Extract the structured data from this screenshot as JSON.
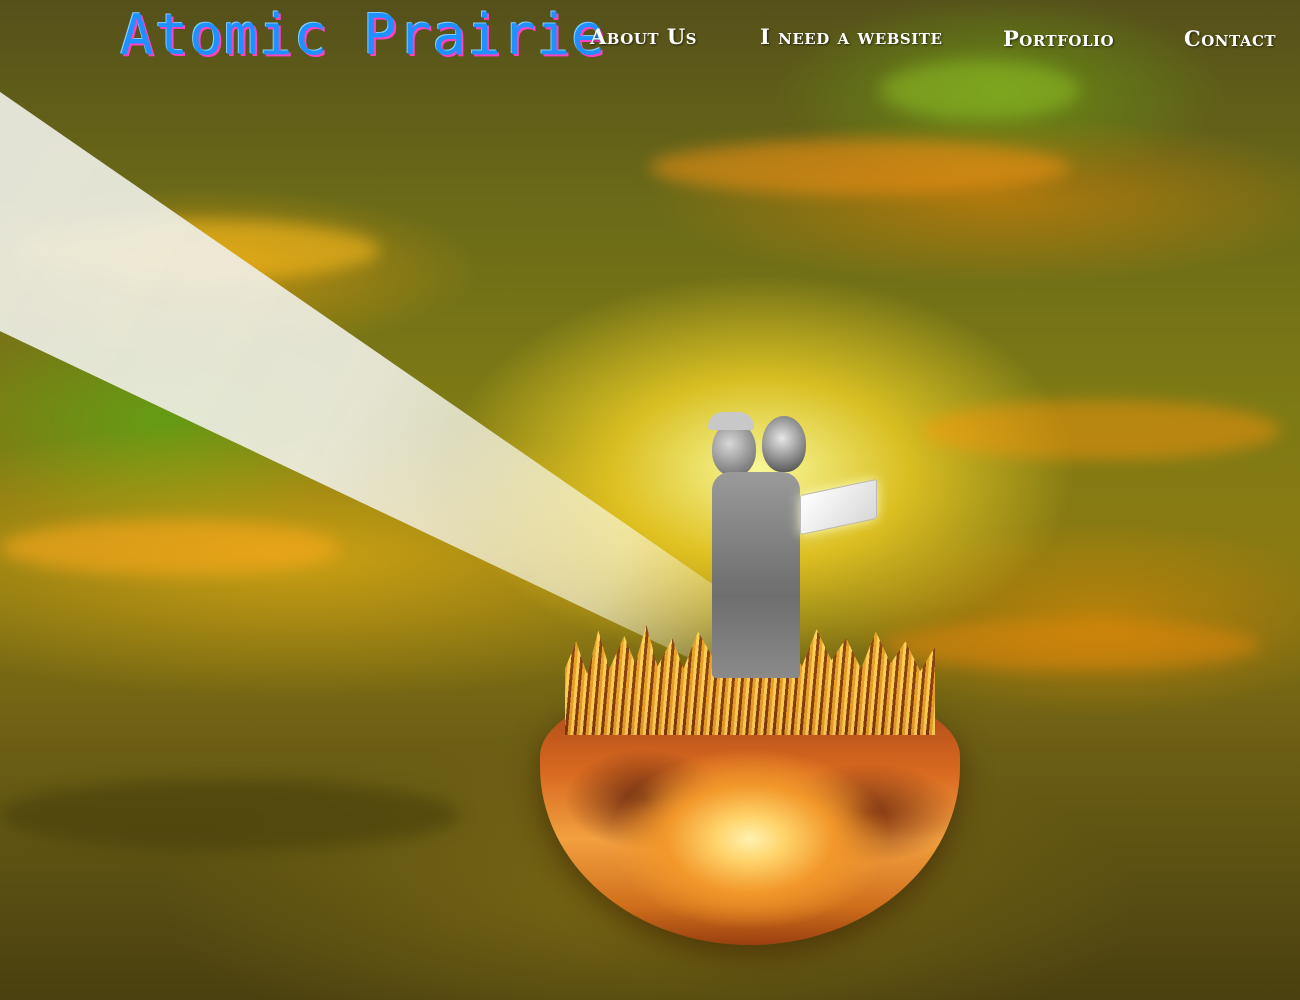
{
  "site": {
    "title": "Atomic Prairie"
  },
  "nav": {
    "items": [
      {
        "label": "About Us"
      },
      {
        "label": "I need a website"
      },
      {
        "label": "Portfolio"
      },
      {
        "label": "Contact"
      }
    ]
  },
  "hero": {
    "image_description_icon": "hero-illustration"
  },
  "colors": {
    "title": "#1e90ff",
    "title_shadow": "#ff40c0",
    "nav_text": "#ffffff"
  }
}
